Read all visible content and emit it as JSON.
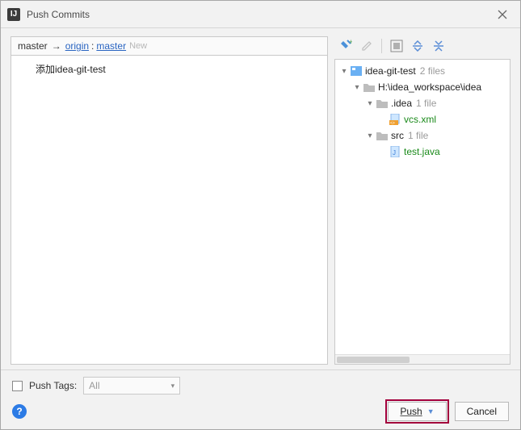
{
  "window": {
    "title": "Push Commits"
  },
  "branch": {
    "local": "master",
    "arrow": "→",
    "remote": "origin",
    "sep": ":",
    "remote_branch": "master",
    "new_tag": "New"
  },
  "commits": [
    {
      "message": "添加idea-git-test"
    }
  ],
  "toolbar": {
    "icons": [
      "pin",
      "edit",
      "group",
      "expand",
      "collapse"
    ]
  },
  "tree": {
    "root": {
      "label": "idea-git-test",
      "meta": "2 files"
    },
    "path": {
      "label": "H:\\idea_workspace\\idea"
    },
    "dirs": [
      {
        "label": ".idea",
        "meta": "1 file",
        "files": [
          {
            "label": "vcs.xml"
          }
        ]
      },
      {
        "label": "src",
        "meta": "1 file",
        "files": [
          {
            "label": "test.java"
          }
        ]
      }
    ]
  },
  "footer": {
    "push_tags_label": "Push Tags:",
    "combo_value": "All",
    "push_label": "Push",
    "cancel_label": "Cancel"
  }
}
